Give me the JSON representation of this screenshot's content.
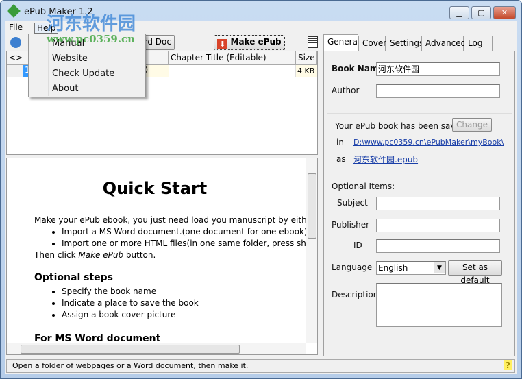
{
  "window": {
    "title": "ePub Maker 1.2"
  },
  "menu": {
    "file": "File",
    "help": "Help",
    "help_items": [
      "Manual",
      "Website",
      "Check Update",
      "About"
    ]
  },
  "toolbar": {
    "word_doc": "ord Doc",
    "make_epub": "Make ePub"
  },
  "table": {
    "columns": [
      "<>",
      "",
      "Chapter Title (Editable)",
      "Size"
    ],
    "rows": [
      {
        "num": "1",
        "file": "0",
        "title": "",
        "size": "4 KB"
      }
    ]
  },
  "doc": {
    "heading": "Quick Start",
    "intro": "Make your ePub ebook, you just need load you manuscript by either t",
    "bullets1": [
      "Import a MS Word document.(one document for one ebook)",
      "Import one or more HTML files(in one same folder, press shift"
    ],
    "then_prefix": "Then click ",
    "then_em": "Make ePub",
    "then_suffix": " button.",
    "optional_heading": "Optional steps",
    "bullets2": [
      "Specify the book name",
      "Indicate a place to save the book",
      "Assign a book cover picture"
    ],
    "word_heading": "For MS Word document"
  },
  "tabs": [
    "General",
    "Cover",
    "Settings",
    "Advanced",
    "Log"
  ],
  "general": {
    "book_name_label": "Book Name",
    "book_name": "河东软件园",
    "author_label": "Author",
    "author": "",
    "saved_text": "Your ePub book has been saved",
    "change": "Change",
    "in_label": "in",
    "path": "D:\\www.pc0359.cn\\ePubMaker\\myBook\\",
    "as_label": "as",
    "filename": "河东软件园.epub",
    "optional": "Optional Items:",
    "subject_label": "Subject",
    "publisher_label": "Publisher",
    "id_label": "ID",
    "language_label": "Language",
    "language": "English",
    "set_default": "Set as default",
    "description_label": "Description"
  },
  "status": {
    "text": "Open a folder of webpages or a Word document, then make it."
  },
  "watermark": {
    "name": "河东软件园",
    "url": "www.pc0359.cn"
  }
}
